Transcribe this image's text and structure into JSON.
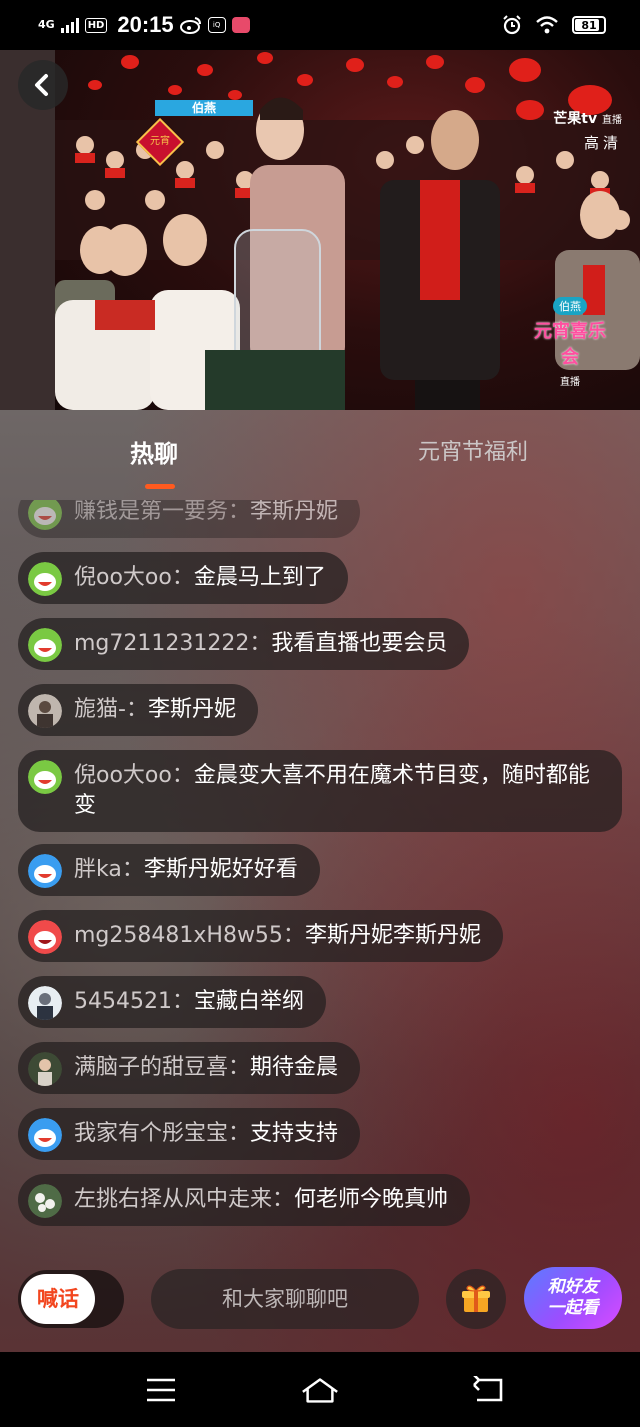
{
  "status_bar": {
    "network": "4G",
    "hd": "HD",
    "time": "20:15",
    "battery": "81"
  },
  "video": {
    "top_badge": "伯燕",
    "corner_badge": "元宵",
    "channel": "芒果tv",
    "channel_sub": "直播",
    "quality": "高清",
    "show_tag": "伯燕",
    "show_name": "元宵喜乐会",
    "live_label": "直播"
  },
  "tabs": [
    {
      "label": "热聊",
      "active": true
    },
    {
      "label": "元宵节福利",
      "active": false
    }
  ],
  "messages": [
    {
      "user": "赚钱是第一要务：",
      "text": "李斯丹妮",
      "avatar": "mascot-icon"
    },
    {
      "user": "倪oo大oo：",
      "text": "金晨马上到了",
      "avatar": "mascot-icon"
    },
    {
      "user": "mg7211231222：",
      "text": "我看直播也要会员",
      "avatar": "mascot-icon"
    },
    {
      "user": "旎猫-：",
      "text": "李斯丹妮",
      "avatar": "photo-avatar"
    },
    {
      "user": "倪oo大oo：",
      "text": "金晨变大喜不用在魔术节目变，随时都能变",
      "avatar": "mascot-icon"
    },
    {
      "user": "胖ka：",
      "text": "李斯丹妮好好看",
      "avatar": "blue-mascot-icon"
    },
    {
      "user": "mg258481xH8w55：",
      "text": "李斯丹妮李斯丹妮",
      "avatar": "red-mascot-icon"
    },
    {
      "user": "5454521：",
      "text": "宝藏白举纲",
      "avatar": "photo-avatar"
    },
    {
      "user": "满脑子的甜豆喜：",
      "text": "期待金晨",
      "avatar": "photo-avatar"
    },
    {
      "user": "我家有个彤宝宝：",
      "text": "支持支持",
      "avatar": "blue-mascot-icon"
    },
    {
      "user": "左挑右择从风中走来：",
      "text": "何老师今晚真帅",
      "avatar": "photo-avatar"
    }
  ],
  "bottom": {
    "shout_label": "喊话",
    "input_placeholder": "和大家聊聊吧",
    "watch_line1": "和好友",
    "watch_line2": "一起看"
  },
  "colors": {
    "accent": "#ff5a1f",
    "watch_gradient_start": "#5b7cff",
    "watch_gradient_end": "#d84bff"
  }
}
